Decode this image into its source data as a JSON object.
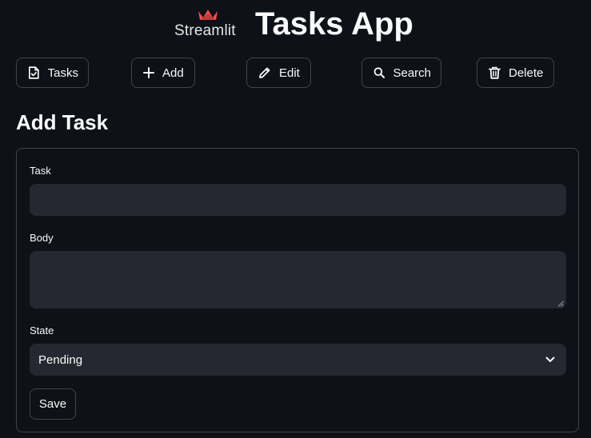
{
  "header": {
    "logo_text": "Streamlit",
    "title": "Tasks App"
  },
  "nav": {
    "tasks_label": "Tasks",
    "add_label": "Add",
    "edit_label": "Edit",
    "search_label": "Search",
    "delete_label": "Delete",
    "icons": [
      "task-file-icon",
      "plus-icon",
      "pencil-icon",
      "search-icon",
      "trash-icon"
    ]
  },
  "form": {
    "section_title": "Add Task",
    "task_label": "Task",
    "task_value": "",
    "body_label": "Body",
    "body_value": "",
    "state_label": "State",
    "state_value": "Pending",
    "save_label": "Save"
  },
  "colors": {
    "background": "#0e1117",
    "input_background": "#262730",
    "logo_red": "#ff4b4b",
    "text": "#fafafa"
  }
}
